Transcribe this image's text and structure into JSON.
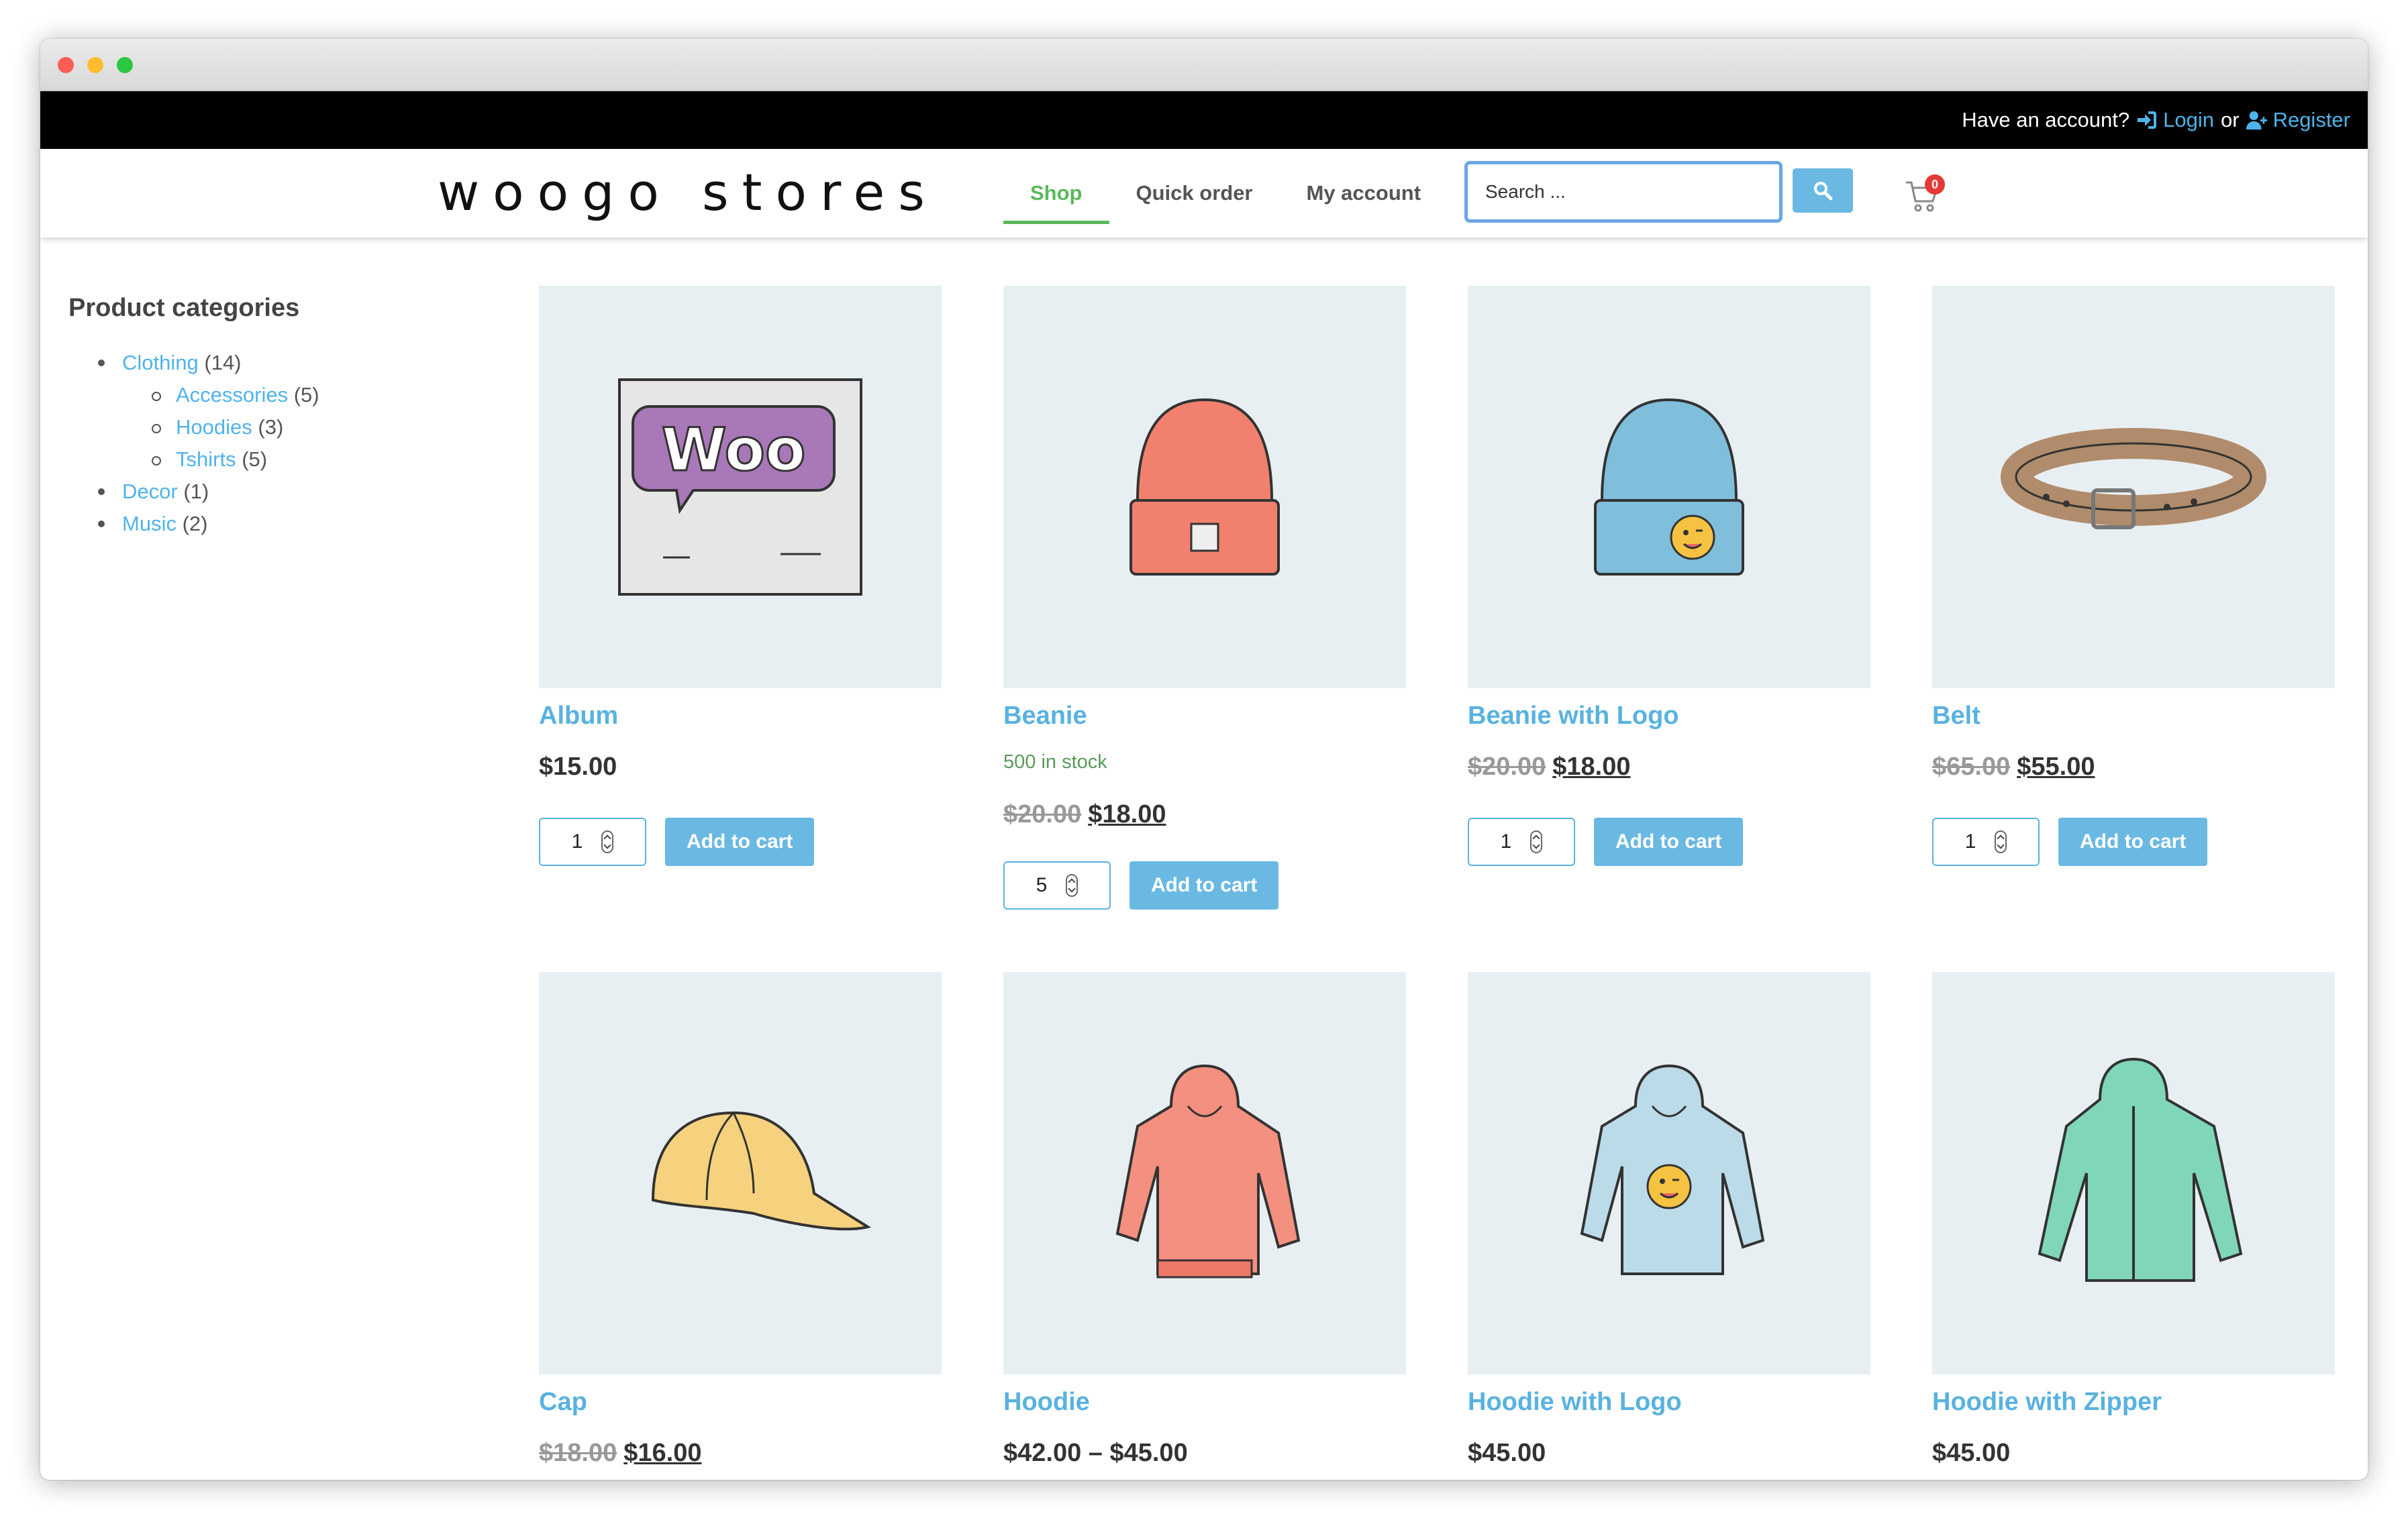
{
  "topbar": {
    "prompt": "Have an account?",
    "login": "Login",
    "or": "or",
    "register": "Register"
  },
  "header": {
    "logo": "woogo stores",
    "nav": [
      {
        "label": "Shop",
        "active": true
      },
      {
        "label": "Quick order"
      },
      {
        "label": "My account"
      }
    ],
    "search_placeholder": "Search ...",
    "cart_count": "0"
  },
  "sidebar": {
    "title": "Product categories",
    "categories": [
      {
        "name": "Clothing",
        "count": "(14)"
      },
      {
        "name": "Accessories",
        "count": "(5)"
      },
      {
        "name": "Hoodies",
        "count": "(3)"
      },
      {
        "name": "Tshirts",
        "count": "(5)"
      },
      {
        "name": "Decor",
        "count": "(1)"
      },
      {
        "name": "Music",
        "count": "(2)"
      }
    ]
  },
  "add_to_cart_label": "Add to cart",
  "products": [
    {
      "title": "Album",
      "price": "$15.00",
      "qty": "1"
    },
    {
      "title": "Beanie",
      "stock": "500 in stock",
      "old_price": "$20.00",
      "price": "$18.00",
      "qty": "5"
    },
    {
      "title": "Beanie with Logo",
      "old_price": "$20.00",
      "price": "$18.00",
      "qty": "1"
    },
    {
      "title": "Belt",
      "old_price": "$65.00",
      "price": "$55.00",
      "qty": "1"
    },
    {
      "title": "Cap",
      "old_price": "$18.00",
      "price": "$16.00"
    },
    {
      "title": "Hoodie",
      "price": "$42.00 – $45.00"
    },
    {
      "title": "Hoodie with Logo",
      "price": "$45.00"
    },
    {
      "title": "Hoodie with Zipper",
      "price": "$45.00"
    }
  ],
  "colors": {
    "accent": "#59b2e0",
    "button": "#6ab9e3",
    "nav_active": "#5cb85c",
    "image_bg": "#e8eff2"
  },
  "icons": [
    "login-icon",
    "register-icon",
    "search-icon",
    "cart-icon"
  ]
}
